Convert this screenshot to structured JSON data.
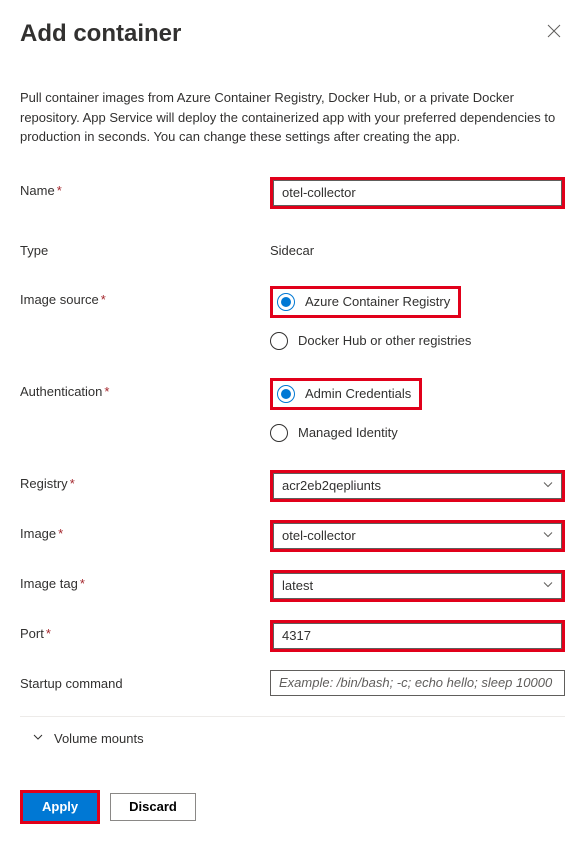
{
  "header": {
    "title": "Add container"
  },
  "description": "Pull container images from Azure Container Registry, Docker Hub, or a private Docker repository. App Service will deploy the containerized app with your preferred dependencies to production in seconds. You can change these settings after creating the app.",
  "fields": {
    "name": {
      "label": "Name",
      "value": "otel-collector"
    },
    "type": {
      "label": "Type",
      "value": "Sidecar"
    },
    "imageSource": {
      "label": "Image source",
      "options": [
        "Azure Container Registry",
        "Docker Hub or other registries"
      ],
      "selected": 0
    },
    "authentication": {
      "label": "Authentication",
      "options": [
        "Admin Credentials",
        "Managed Identity"
      ],
      "selected": 0
    },
    "registry": {
      "label": "Registry",
      "value": "acr2eb2qepliunts"
    },
    "image": {
      "label": "Image",
      "value": "otel-collector"
    },
    "imageTag": {
      "label": "Image tag",
      "value": "latest"
    },
    "port": {
      "label": "Port",
      "value": "4317"
    },
    "startupCommand": {
      "label": "Startup command",
      "value": "",
      "placeholder": "Example: /bin/bash; -c; echo hello; sleep 10000"
    }
  },
  "expander": {
    "label": "Volume mounts"
  },
  "footer": {
    "apply": "Apply",
    "discard": "Discard"
  }
}
